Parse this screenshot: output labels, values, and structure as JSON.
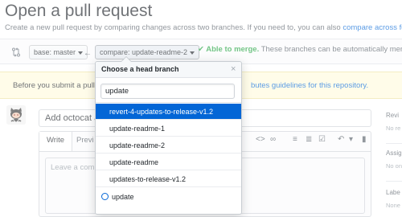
{
  "header": {
    "title": "Open a pull request",
    "subtitle_text": "Create a new pull request by comparing changes across two branches. If you need to, you can also",
    "subtitle_link": "compare across forks."
  },
  "range": {
    "base_label": "base: master",
    "compare_label": "compare: update-readme-2",
    "merge_ok": "✔ Able to merge.",
    "merge_note": "These branches can be automatically merged."
  },
  "banner": {
    "text": "Before you submit a pull r",
    "link": "butes guidelines for this repository."
  },
  "form": {
    "title_value": "Add octocat a",
    "tab_write": "Write",
    "tab_preview": "Previ",
    "comment_placeholder": "Leave a comment"
  },
  "sidebar": {
    "reviewers_label": "Revi",
    "reviewers_value": "No re",
    "assignees_label": "Assig",
    "assignees_value": "No on",
    "labels_label": "Labe",
    "labels_value": "None"
  },
  "dropdown": {
    "title": "Choose a head branch",
    "close_glyph": "×",
    "filter_value": "update",
    "items": [
      {
        "label": "revert-4-updates-to-release-v1.2",
        "selected": true
      },
      {
        "label": "update-readme-1",
        "selected": false
      },
      {
        "label": "update-readme-2",
        "selected": false
      },
      {
        "label": "update-readme",
        "selected": false
      },
      {
        "label": "updates-to-release-v1.2",
        "selected": false
      }
    ],
    "create_item": "update"
  },
  "colors": {
    "link": "#0366d6",
    "ok": "#28a745",
    "selected_bg": "#0366d6",
    "banner_bg": "#fffbdd"
  }
}
